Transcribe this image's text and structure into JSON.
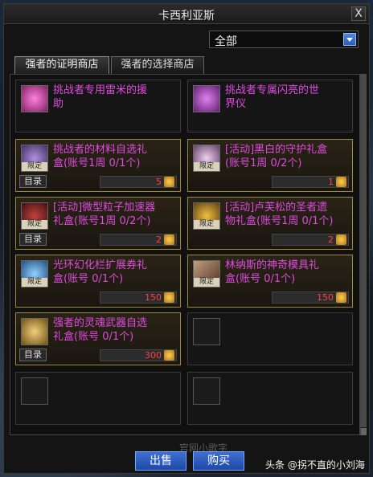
{
  "window": {
    "title": "卡西利亚斯",
    "close_label": "X"
  },
  "filter": {
    "selected": "全部"
  },
  "tabs": [
    {
      "label": "强者的证明商店",
      "active": true
    },
    {
      "label": "强者的选择商店",
      "active": false
    }
  ],
  "items": [
    {
      "name": "挑战者专用雷米的援\n助",
      "style": "plain",
      "icon_color": "#e060c0"
    },
    {
      "name": "挑战者专属闪亮的世\n界仪",
      "style": "plain",
      "icon_color": "#c040c0"
    },
    {
      "name": "挑战者的材料自选礼\n盒(账号1周 0/1个)",
      "style": "gold",
      "limited": "限定",
      "catalog": "目录",
      "price": "5",
      "icon_color": "#a080d0"
    },
    {
      "name": "[活动]黑白的守护礼盒\n(账号1周 0/2个)",
      "style": "gold",
      "limited": "限定",
      "price": "1",
      "icon_color": "#d0a0d0"
    },
    {
      "name": "[活动]微型粒子加速器\n礼盒(账号1周 0/2个)",
      "style": "gold",
      "limited": "限定",
      "catalog": "目录",
      "price": "2",
      "icon_color": "#a03030"
    },
    {
      "name": "[活动]卢芙松的圣者遗\n物礼盒(账号1周 0/1个)",
      "style": "gold",
      "limited": "限定",
      "price": "2",
      "icon_color": "#c09020"
    },
    {
      "name": "光环幻化栏扩展券礼\n盒(账号 0/1个)",
      "style": "gold",
      "limited": "限定",
      "price": "150",
      "icon_color": "#60a0e0"
    },
    {
      "name": "林纳斯的神奇模具礼\n盒(账号 0/1个)",
      "style": "gold",
      "limited": "限定",
      "price": "150",
      "icon_color": "#806040"
    },
    {
      "name": "强者的灵魂武器自选\n礼盒(账号 0/1个)",
      "style": "gold",
      "catalog": "目录",
      "price": "300",
      "icon_color": "#c0a040"
    }
  ],
  "buttons": {
    "sell": "出售",
    "buy": "购买"
  },
  "watermark": "头条 @拐不直的小刘海",
  "overlay": "官网小歌字",
  "colors": {
    "item_name": "#e04ae0",
    "price": "#ff4040",
    "gold_border": "#a08a3a"
  }
}
